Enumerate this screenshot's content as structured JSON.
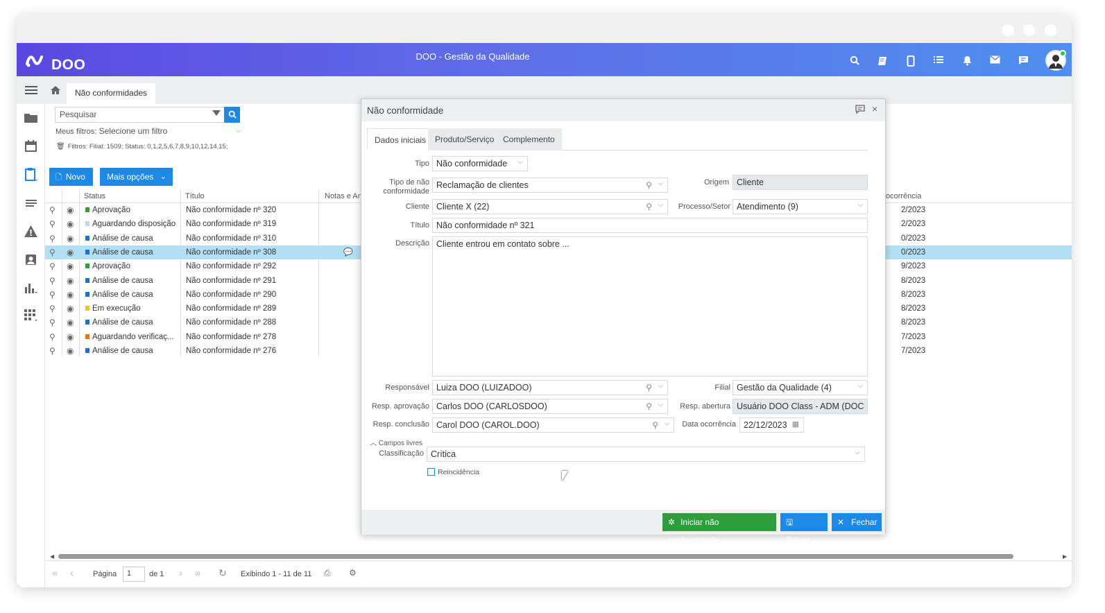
{
  "app": {
    "name": "DOO",
    "title": "DOO - Gestão da Qualidade"
  },
  "topbar_icons": [
    "search-icon",
    "book-icon",
    "mobile-icon",
    "list-icon",
    "bell-icon",
    "mail-icon",
    "chat-icon"
  ],
  "tabs": {
    "active": "Não conformidades"
  },
  "list": {
    "search_placeholder": "Pesquisar",
    "my_filters_label": "Meus filtros:",
    "my_filters_value": "Selecione um filtro",
    "filters_text": "Filtros: Filial: 1509; Status: 0,1,2,5,6,7,8,9,10,12,14,15;",
    "new_label": "Novo",
    "more_label": "Mais opções",
    "columns": [
      "Status",
      "Título",
      "Notas e An",
      "ocorrência"
    ],
    "rows": [
      {
        "status": "Aprovação",
        "color": "#2e9e2e",
        "title": "Não conformidade nº 320",
        "date": "2/2023"
      },
      {
        "status": "Aguardando disposição",
        "color": "#bcd7ee",
        "title": "Não conformidade nº 319",
        "date": "2/2023"
      },
      {
        "status": "Análise de causa",
        "color": "#1e6fd0",
        "title": "Não conformidade nº 310",
        "date": "0/2023"
      },
      {
        "status": "Análise de causa",
        "color": "#1e6fd0",
        "title": "Não conformidade nº 308",
        "date": "0/2023",
        "selected": true
      },
      {
        "status": "Aprovação",
        "color": "#2e9e2e",
        "title": "Não conformidade nº 292",
        "date": "9/2023"
      },
      {
        "status": "Análise de causa",
        "color": "#1e6fd0",
        "title": "Não conformidade nº 291",
        "date": "8/2023"
      },
      {
        "status": "Análise de causa",
        "color": "#1e6fd0",
        "title": "Não conformidade nº 290",
        "date": "8/2023"
      },
      {
        "status": "Em execução",
        "color": "#f0c419",
        "title": "Não conformidade nº 289",
        "date": "8/2023"
      },
      {
        "status": "Análise de causa",
        "color": "#1e6fd0",
        "title": "Não conformidade nº 288",
        "date": "8/2023"
      },
      {
        "status": "Aguardando verificaç...",
        "color": "#e8731a",
        "title": "Não conformidade nº 278",
        "date": "7/2023"
      },
      {
        "status": "Análise de causa",
        "color": "#1e6fd0",
        "title": "Não conformidade nº 276",
        "date": "7/2023"
      }
    ],
    "pager": {
      "page_label": "Página",
      "page": "1",
      "of": "de 1",
      "showing": "Exibindo 1 - 11 de 11"
    }
  },
  "modal": {
    "title": "Não conformidade",
    "tabs": [
      "Dados iniciais",
      "Produto/Serviço",
      "Complemento"
    ],
    "labels": {
      "tipo": "Tipo",
      "tipo_nc": "Tipo de não conformidade",
      "origem": "Origem",
      "cliente": "Cliente",
      "processo": "Processo/Setor",
      "titulo": "Título",
      "descricao": "Descrição",
      "responsavel": "Responsável",
      "filial": "Filial",
      "resp_aprov": "Resp. aprovação",
      "resp_abertura": "Resp. abertura",
      "resp_conclusao": "Resp. conclusão",
      "data_ocorrencia": "Data ocorrência",
      "campos_livres": "Campos livres",
      "classificacao": "Classificação",
      "reincidencia": "Reincidência"
    },
    "values": {
      "tipo": "Não conformidade",
      "tipo_nc": "Reclamação de clientes",
      "origem": "Cliente",
      "cliente": "Cliente X (22)",
      "processo": "Atendimento (9)",
      "titulo": "Não conformidade nº 321",
      "descricao": "Cliente entrou em contato sobre ...",
      "responsavel": "Luiza DOO (LUIZADOO)",
      "filial": "Gestão da Qualidade (4)",
      "resp_aprov": "Carlos DOO (CARLOSDOO)",
      "resp_abertura": "Usuário DOO Class - ADM (DOC",
      "resp_conclusao": "Carol DOO (CAROL.DOO)",
      "data_ocorrencia": "22/12/2023",
      "classificacao": "Crítica"
    },
    "buttons": {
      "start": "Iniciar não conformidade",
      "save": "Salvar",
      "close": "Fechar"
    },
    "colors": {
      "start": "#2e9e3c",
      "save": "#1e88e5",
      "close": "#1e88e5"
    }
  }
}
